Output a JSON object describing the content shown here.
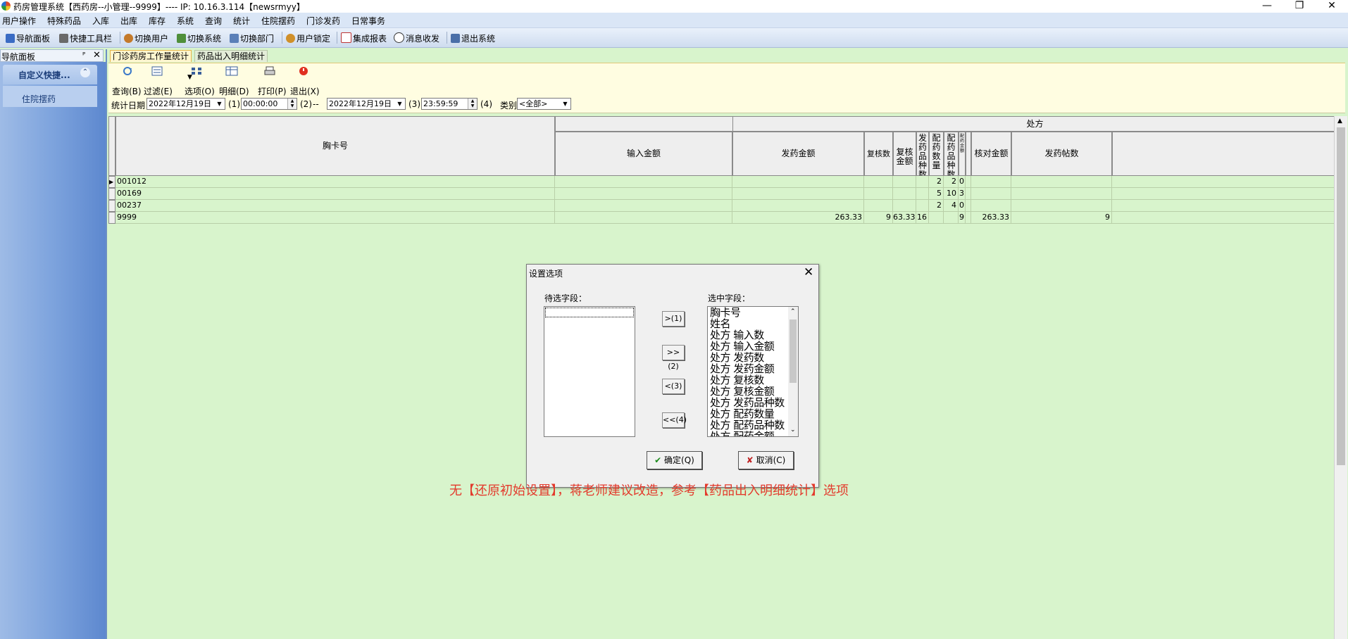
{
  "window": {
    "title": "药房管理系统【西药房--小管理--9999】---- IP: 10.16.3.114【newsrmyy】",
    "minimize": "—",
    "restore": "❐",
    "close": "✕"
  },
  "menubar": {
    "items": [
      "用户操作",
      "特殊药品",
      "入库",
      "出库",
      "库存",
      "系统",
      "查询",
      "统计",
      "住院摆药",
      "门诊发药",
      "日常事务"
    ]
  },
  "toolbar": {
    "items": [
      "导航面板",
      "快捷工具栏",
      "切换用户",
      "切换系统",
      "切换部门",
      "用户锁定",
      "集成报表",
      "消息收发",
      "退出系统"
    ]
  },
  "nav": {
    "header": "导航面板",
    "pin": "ᴾ",
    "close": "✕",
    "group": "自定义快捷...",
    "group_chevron": "⌃",
    "items": [
      "住院摆药"
    ]
  },
  "tabs": [
    "门诊药房工作量统计",
    "药品出入明细统计"
  ],
  "actions": {
    "query": "查询(B)",
    "filter": "过滤(E)",
    "filter_arrow": "▼",
    "options": "选项(O)",
    "detail": "明细(D)",
    "print": "打印(P)",
    "exit": "退出(X)"
  },
  "filter": {
    "date_label": "统计日期",
    "start_date": "2022年12月19日",
    "n1": "(1)",
    "start_time": "00:00:00",
    "n2": "(2)",
    "sep": "--",
    "end_date": "2022年12月19日",
    "n3": "(3)",
    "end_time": "23:59:59",
    "n4": "(4)",
    "category_label": "类别",
    "category_value": "<全部>",
    "dropdown_arrow": "▼",
    "spin_up": "▲",
    "spin_down": "▼"
  },
  "grid": {
    "group_header": "处方",
    "headers": {
      "card": "胸卡号",
      "input_amount": "输入金额",
      "issue_amount": "发药金额",
      "recheck_count": "复核数",
      "recheck_amount": "复核金额",
      "issue_kinds": "发药品种数",
      "dispense_qty": "配药数量",
      "dispense_kinds": "配药品种数",
      "dispense_extra": "配药金额",
      "check_amount": "核对金额",
      "issue_posts": "发药帖数"
    },
    "row_marker": "▶",
    "rows": [
      {
        "card": "001012",
        "input_amount": "",
        "issue_amount": "",
        "recheck_count": "",
        "recheck_amount": "",
        "issue_kinds": "",
        "dispense_qty": "2",
        "dispense_kinds": "2",
        "dispense_extra": "0",
        "check_amount": "",
        "issue_posts": ""
      },
      {
        "card": "00169",
        "input_amount": "",
        "issue_amount": "",
        "recheck_count": "",
        "recheck_amount": "",
        "issue_kinds": "",
        "dispense_qty": "5",
        "dispense_kinds": "10",
        "dispense_extra": "3",
        "check_amount": "",
        "issue_posts": ""
      },
      {
        "card": "00237",
        "input_amount": "",
        "issue_amount": "",
        "recheck_count": "",
        "recheck_amount": "",
        "issue_kinds": "",
        "dispense_qty": "2",
        "dispense_kinds": "4",
        "dispense_extra": "0",
        "check_amount": "",
        "issue_posts": ""
      },
      {
        "card": "9999",
        "input_amount": "",
        "issue_amount": "263.33",
        "recheck_count": "9",
        "recheck_amount": "63.33",
        "issue_kinds": "16",
        "dispense_qty": "",
        "dispense_kinds": "",
        "dispense_extra": "9",
        "check_amount": "263.33",
        "issue_posts": "9"
      }
    ]
  },
  "dialog": {
    "title": "设置选项",
    "close": "✕",
    "available_label": "待选字段：",
    "selected_label": "选中字段：",
    "available_fields": [],
    "selected_fields": [
      "胸卡号",
      "姓名",
      "处方 输入数",
      "处方 输入金额",
      "处方 发药数",
      "处方 发药金额",
      "处方 复核数",
      "处方 复核金额",
      "处方 发药品种数",
      "处方 配药数量",
      "处方 配药品种数",
      "处方 配药金额"
    ],
    "btn_add": ">(1)",
    "btn_add_all": ">>(2)",
    "btn_remove": "<(3)",
    "btn_remove_all": "<<(4)",
    "ok": "确定(Q)",
    "ok_icon": "✔",
    "cancel": "取消(C)",
    "cancel_icon": "✘",
    "scroll_up": "⌃",
    "scroll_down": "⌄"
  },
  "note": "无【还原初始设置】，蒋老师建议改造，参考【药品出入明细统计】选项",
  "scroll_up": "▲",
  "colors": {
    "content_bg": "#d8f4cc",
    "toolbar_bg": "#fffde1",
    "nav_bg": "#7da3dd",
    "note": "#e33a2c"
  }
}
